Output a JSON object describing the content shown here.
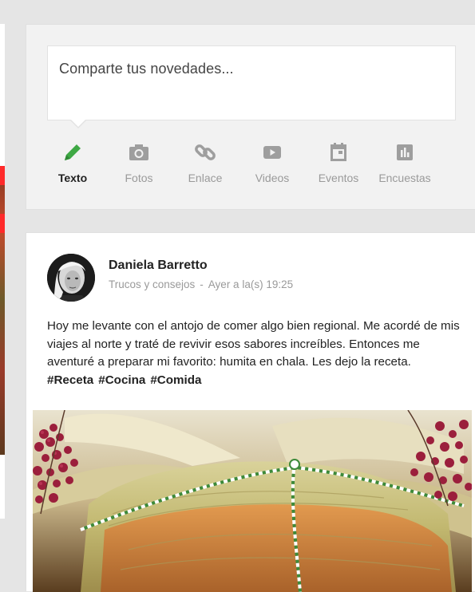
{
  "composer": {
    "placeholder": "Comparte tus novedades...",
    "tabs": [
      {
        "label": "Texto",
        "icon": "pencil-icon",
        "active": true
      },
      {
        "label": "Fotos",
        "icon": "camera-icon",
        "active": false
      },
      {
        "label": "Enlace",
        "icon": "link-icon",
        "active": false
      },
      {
        "label": "Videos",
        "icon": "video-play-icon",
        "active": false
      },
      {
        "label": "Eventos",
        "icon": "calendar-icon",
        "active": false
      },
      {
        "label": "Encuestas",
        "icon": "poll-chart-icon",
        "active": false
      }
    ],
    "colors": {
      "active_icon": "#3ea844",
      "inactive_icon": "#9e9e9e"
    }
  },
  "post": {
    "author": "Daniela Barretto",
    "category": "Trucos y consejos",
    "separator": "-",
    "timestamp": "Ayer a la(s) 19:25",
    "body": "Hoy me levante con el antojo de comer algo bien regional. Me acordé de mis viajes al norte y traté de revivir esos sabores increíbles. Entonces me aventuré a preparar mi favorito: humita en chala. Les dejo la receta.",
    "hashtags": [
      "#Receta",
      "#Cocina",
      "#Comida"
    ]
  }
}
